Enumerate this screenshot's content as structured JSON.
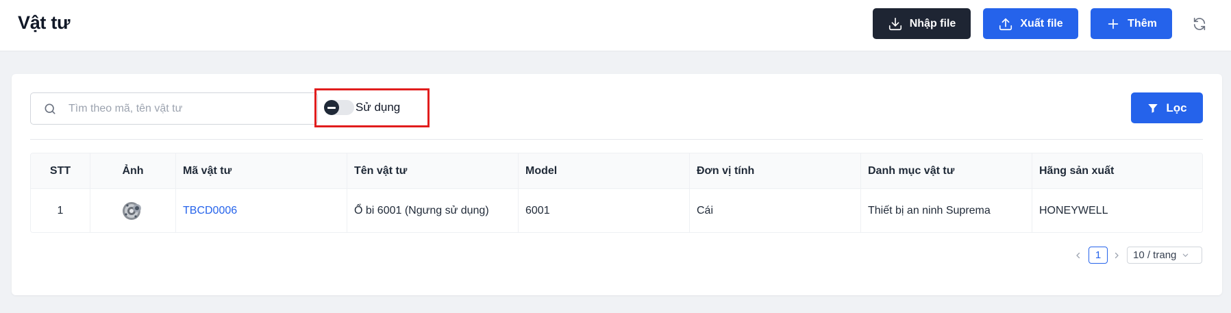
{
  "page": {
    "title": "Vật tư"
  },
  "header": {
    "import_label": "Nhập file",
    "export_label": "Xuất file",
    "add_label": "Thêm"
  },
  "toolbar": {
    "search_placeholder": "Tìm theo mã, tên vật tư",
    "search_value": "",
    "toggle_label": "Sử dụng",
    "toggle_on": false,
    "filter_label": "Lọc"
  },
  "table": {
    "columns": [
      "STT",
      "Ảnh",
      "Mã vật tư",
      "Tên vật tư",
      "Model",
      "Đơn vị tính",
      "Danh mục vật tư",
      "Hãng sản xuất"
    ],
    "rows": [
      {
        "stt": "1",
        "image": "bearing-thumbnail",
        "code": "TBCD0006",
        "name": "Ổ bi 6001 (Ngưng sử dụng)",
        "model": "6001",
        "unit": "Cái",
        "category": "Thiết bị an ninh Suprema",
        "manufacturer": "HONEYWELL"
      }
    ]
  },
  "pagination": {
    "current": "1",
    "page_size": "10 / trang"
  },
  "colors": {
    "primary": "#2563eb",
    "dark_button": "#1e2533",
    "highlight_border": "#e11d1d",
    "background": "#f0f2f5"
  },
  "icons": [
    "download-icon",
    "upload-icon",
    "plus-icon",
    "refresh-icon",
    "search-icon",
    "filter-icon",
    "chevron-left-icon",
    "chevron-right-icon",
    "chevron-down-icon"
  ]
}
